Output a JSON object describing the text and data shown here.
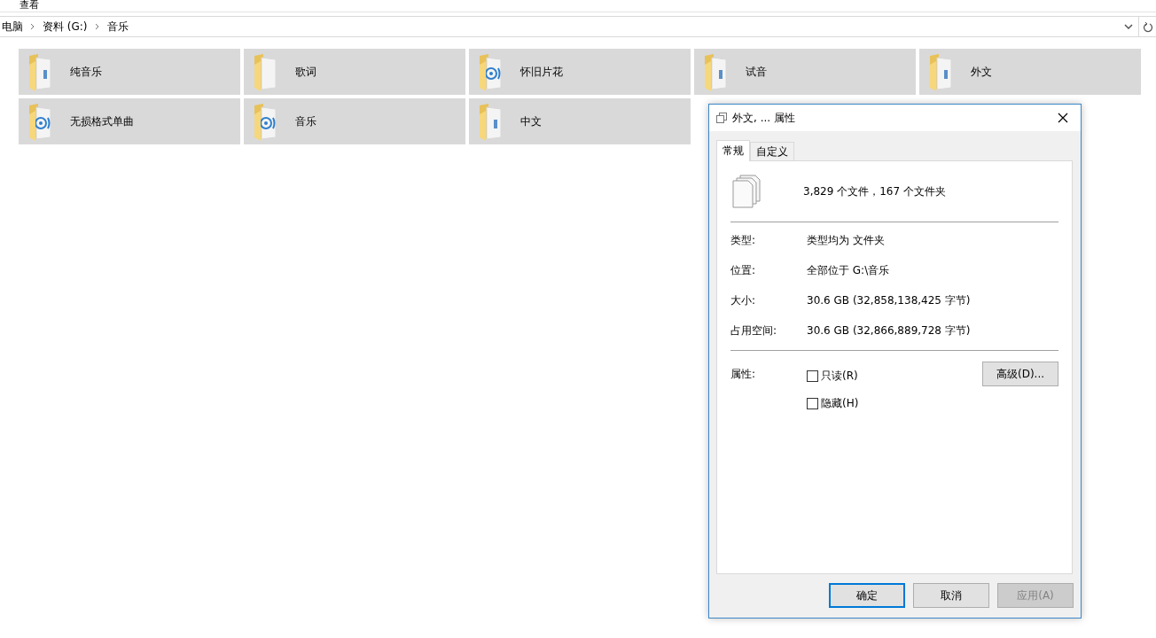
{
  "ribbon": {
    "tab": "查看"
  },
  "address_bar": {
    "crumbs": [
      "电脑",
      "资料 (G:)",
      "音乐"
    ]
  },
  "folders": [
    {
      "name": "纯音乐",
      "kind": "document"
    },
    {
      "name": "歌词",
      "kind": "blank"
    },
    {
      "name": "怀旧片花",
      "kind": "music"
    },
    {
      "name": "试音",
      "kind": "document"
    },
    {
      "name": "外文",
      "kind": "document"
    },
    {
      "name": "无损格式单曲",
      "kind": "music"
    },
    {
      "name": "音乐",
      "kind": "music"
    },
    {
      "name": "中文",
      "kind": "document"
    }
  ],
  "dialog": {
    "title": "外文, ... 属性",
    "tabs": [
      {
        "label": "常规",
        "selected": true
      },
      {
        "label": "自定义",
        "selected": false
      }
    ],
    "summary": "3,829 个文件，167 个文件夹",
    "rows": [
      {
        "label": "类型:",
        "value": "类型均为 文件夹"
      },
      {
        "label": "位置:",
        "value": "全部位于 G:\\音乐"
      },
      {
        "label": "大小:",
        "value": "30.6 GB (32,858,138,425 字节)"
      },
      {
        "label": "占用空间:",
        "value": "30.6 GB (32,866,889,728 字节)"
      }
    ],
    "attributes_label": "属性:",
    "attributes": [
      {
        "label": "只读(R)",
        "checked": false
      },
      {
        "label": "隐藏(H)",
        "checked": false
      }
    ],
    "advanced_button": "高级(D)...",
    "buttons": [
      {
        "label": "确定",
        "default": true,
        "disabled": false
      },
      {
        "label": "取消",
        "default": false,
        "disabled": false
      },
      {
        "label": "应用(A)",
        "default": false,
        "disabled": true
      }
    ]
  }
}
